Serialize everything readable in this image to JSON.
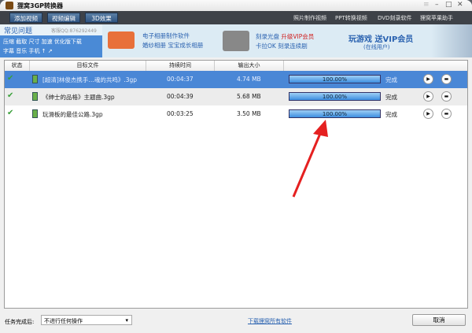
{
  "app": {
    "title": "狸窝3GP转换器"
  },
  "toolbar": {
    "buttons": [
      "添加视频",
      "视频编辑",
      "3D效果"
    ],
    "links": [
      "照片制作视频",
      "PPT转换视频",
      "DVD刻录软件",
      "狸窝苹果助手"
    ]
  },
  "banner": {
    "faq_title": "常见问题",
    "qq": "客服QQ:876292449",
    "faq_line1": "压缩 截取 尺寸 加速 优化版下载",
    "faq_line2": "字幕 音乐 手机 ↑ ↗",
    "ad1_line1": "电子相册制作软件",
    "ad1_line2": "婚纱相册 宝宝成长相册",
    "ad2_line1a": "刻录光盘",
    "ad2_line1b": "升级VIP会员",
    "ad2_line2": "卡拉OK 刻录连续剧",
    "promo": "玩游戏 送VIP会员",
    "promo_sub": "(在线用户)"
  },
  "table": {
    "headers": [
      "状态",
      "目标文件",
      "持续时间",
      "输出大小"
    ],
    "rows": [
      {
        "file": "[超清]林俊杰携手…魂的共鸣》.3gp",
        "duration": "00:04:37",
        "size": "4.74 MB",
        "progress": "100.00%",
        "status": "完成"
      },
      {
        "file": "《绅士的品格》主题曲.3gp",
        "duration": "00:04:39",
        "size": "5.68 MB",
        "progress": "100.00%",
        "status": "完成"
      },
      {
        "file": "玩滑板的最佳公路.3gp",
        "duration": "00:03:25",
        "size": "3.50 MB",
        "progress": "100.00%",
        "status": "完成"
      }
    ]
  },
  "bottom": {
    "label": "任务完成后:",
    "select": "不进行任何操作",
    "link": "下载狸窝所有软件",
    "cancel": "取消"
  }
}
